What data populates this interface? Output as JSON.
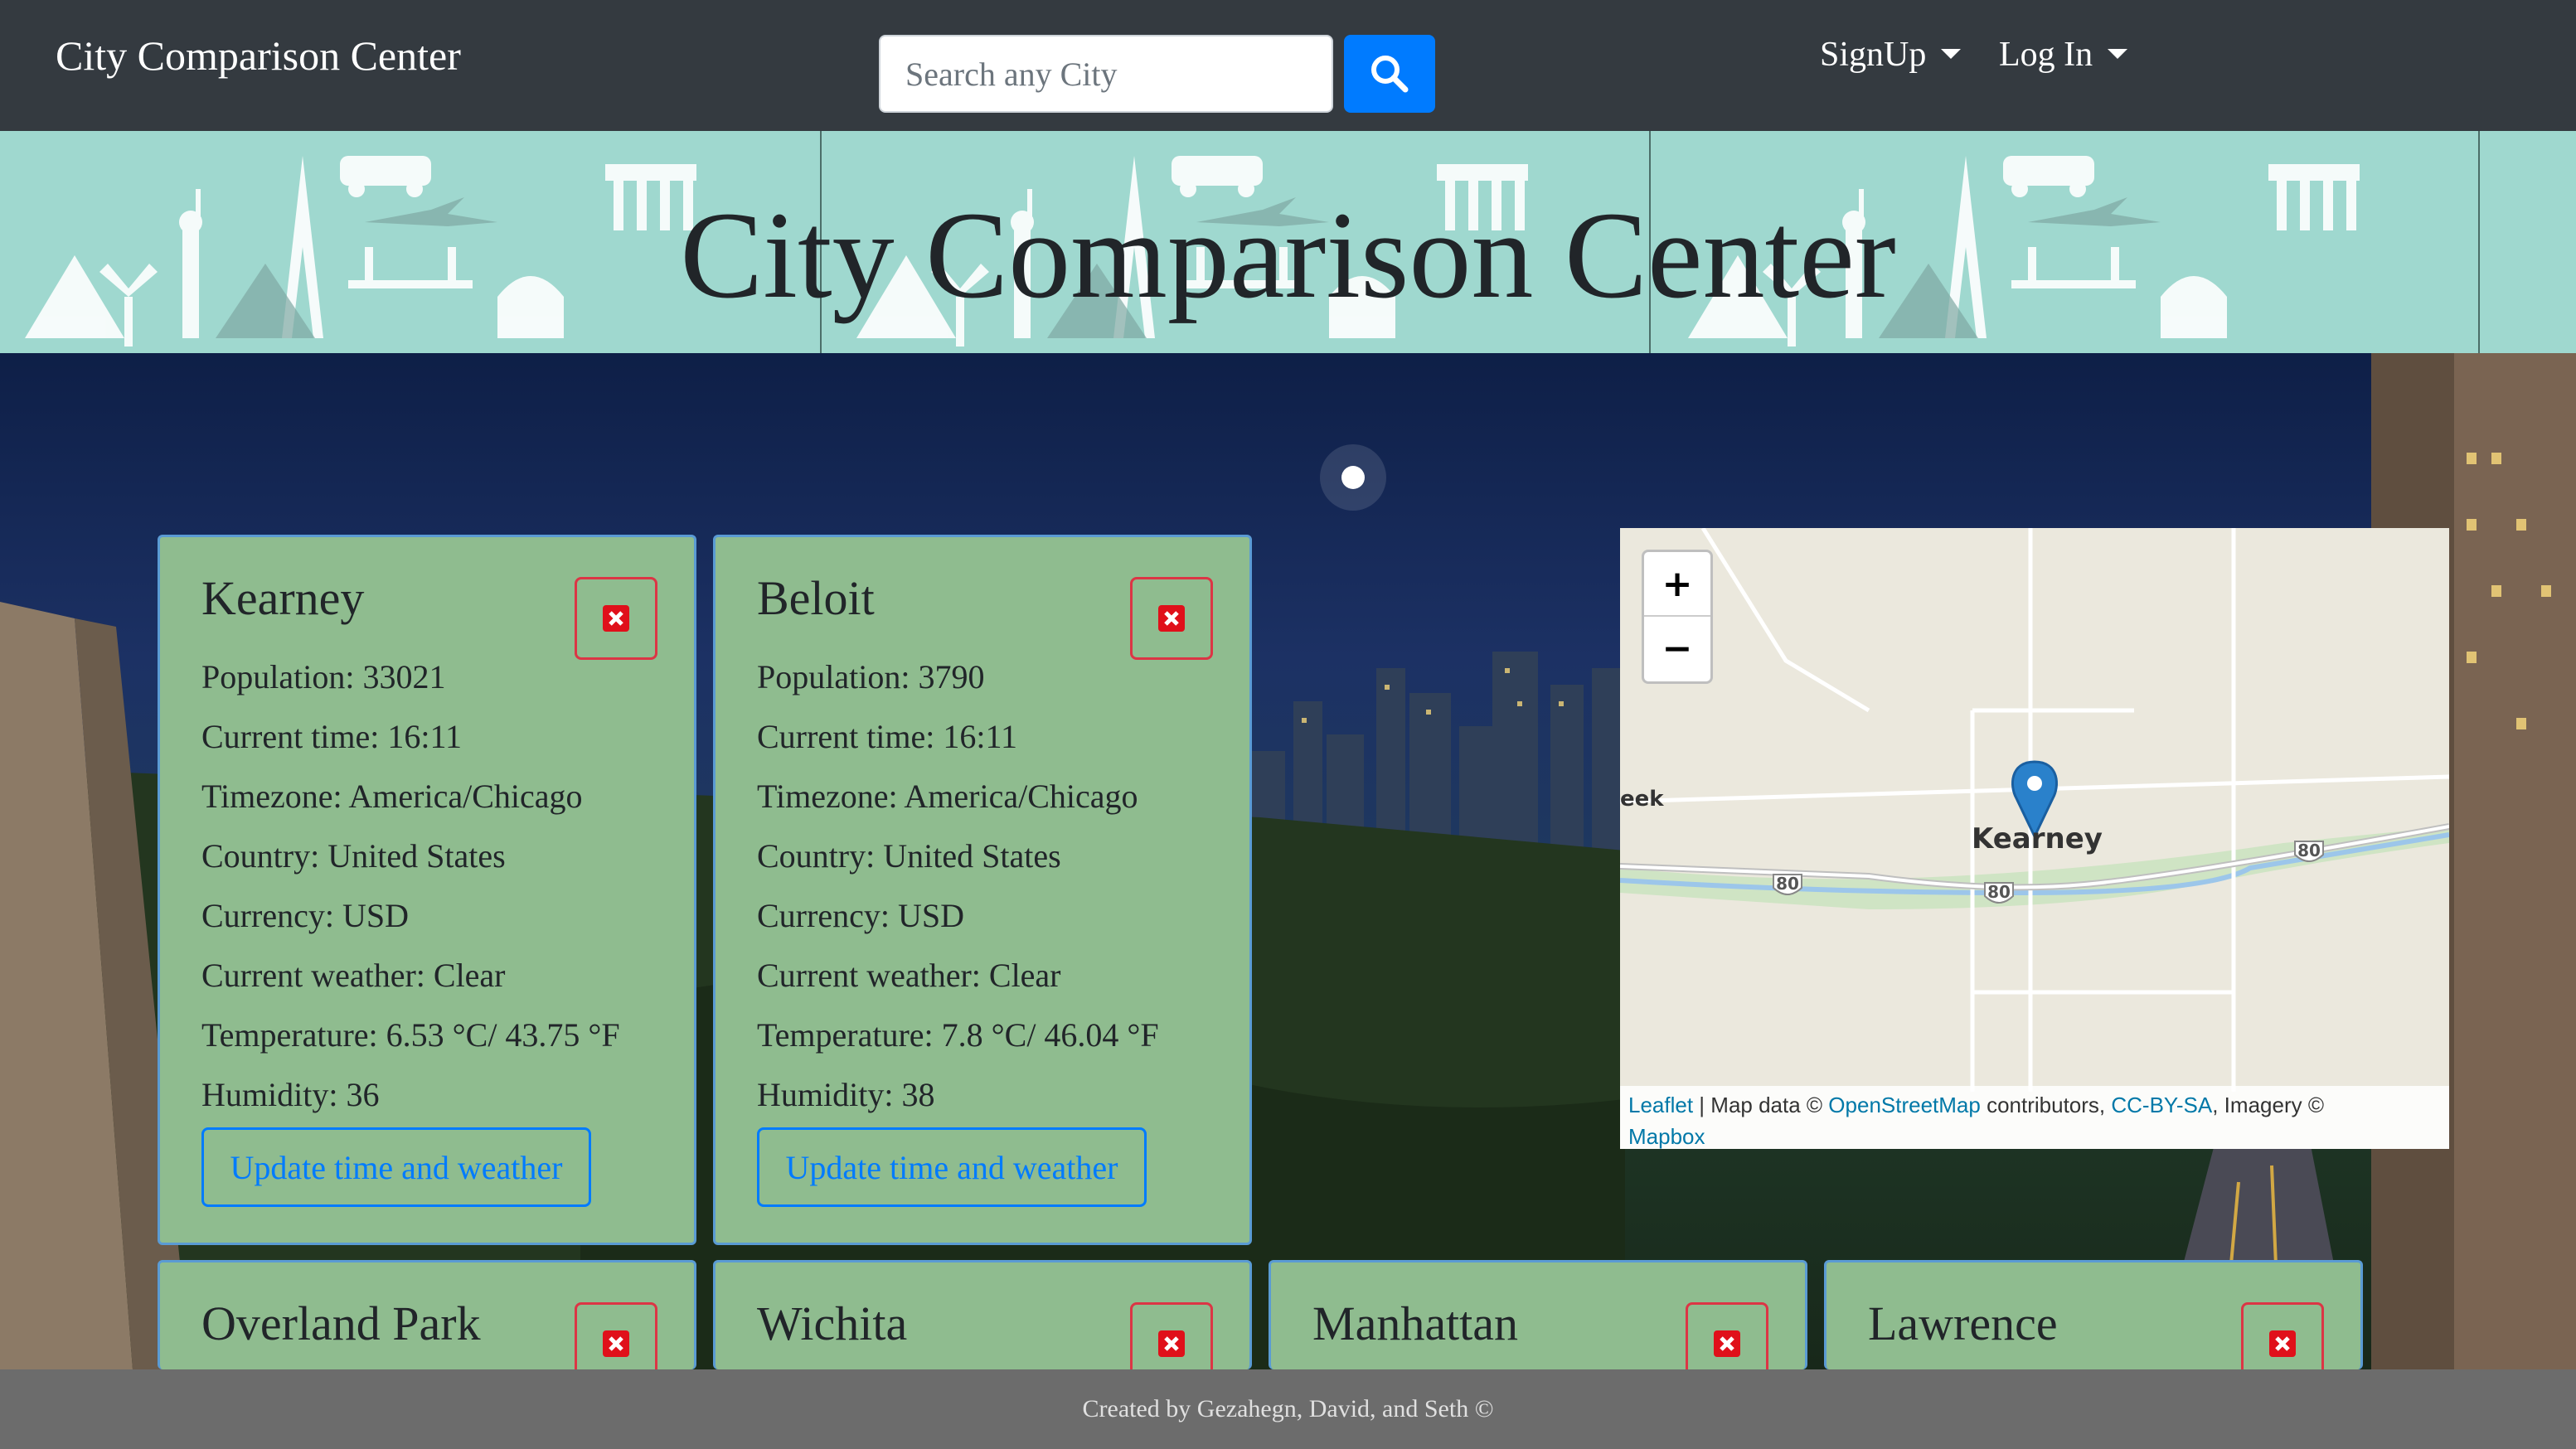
{
  "navbar": {
    "brand": "City Comparison Center",
    "search_placeholder": "Search any City",
    "search_icon": "search-icon",
    "signup_label": "SignUp",
    "login_label": "Log In"
  },
  "banner": {
    "title": "City Comparison Center"
  },
  "cards": [
    {
      "name": "Kearney",
      "population": "Population: 33021",
      "time": "Current time: 16:11",
      "timezone": "Timezone: America/Chicago",
      "country": "Country: United States",
      "currency": "Currency: USD",
      "weather": "Current weather: Clear",
      "temperature": "Temperature: 6.53 °C/ 43.75 °F",
      "humidity": "Humidity: 36",
      "update_label": "Update time and weather"
    },
    {
      "name": "Beloit",
      "population": "Population: 3790",
      "time": "Current time: 16:11",
      "timezone": "Timezone: America/Chicago",
      "country": "Country: United States",
      "currency": "Currency: USD",
      "weather": "Current weather: Clear",
      "temperature": "Temperature: 7.8 °C/ 46.04 °F",
      "humidity": "Humidity: 38",
      "update_label": "Update time and weather"
    },
    {
      "name": "Overland Park"
    },
    {
      "name": "Wichita"
    },
    {
      "name": "Manhattan"
    },
    {
      "name": "Lawrence"
    }
  ],
  "map": {
    "city_label": "Kearney",
    "edge_label": "eek",
    "highway": "80",
    "zoom_in": "+",
    "zoom_out": "−",
    "attribution": {
      "leaflet": "Leaflet",
      "sep1": " | Map data © ",
      "osm": "OpenStreetMap",
      "sep2": " contributors, ",
      "license": "CC-BY-SA",
      "sep3": ", Imagery © ",
      "mapbox": "Mapbox"
    }
  },
  "footer": {
    "text": "Created by Gezahegn, David, and Seth ©"
  },
  "colors": {
    "navbar": "#343a40",
    "banner": "#9fd8cf",
    "card": "#8fbc8f",
    "primary": "#007bff",
    "danger": "#dc3545",
    "footer": "#6c6c6c"
  }
}
